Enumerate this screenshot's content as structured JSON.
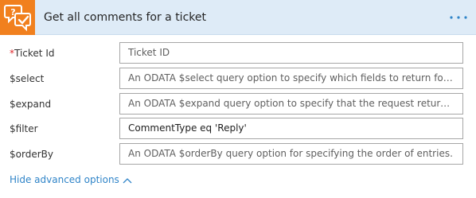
{
  "header": {
    "title": "Get all comments for a ticket",
    "icon": "ticket-comments-icon",
    "menu_icon": "more-options-icon",
    "accent_color": "#f1801e",
    "background_color": "#deebf7"
  },
  "fields": [
    {
      "label": "Ticket Id",
      "required": true,
      "required_marker": "*",
      "value": "",
      "placeholder": "Ticket ID"
    },
    {
      "label": "$select",
      "required": false,
      "value": "",
      "placeholder": "An ODATA $select query option to specify which fields to return for a list ite..."
    },
    {
      "label": "$expand",
      "required": false,
      "value": "",
      "placeholder": "An ODATA $expand query option to specify that the request returns the val..."
    },
    {
      "label": "$filter",
      "required": false,
      "value": "CommentType eq 'Reply'",
      "placeholder": ""
    },
    {
      "label": "$orderBy",
      "required": false,
      "value": "",
      "placeholder": "An ODATA $orderBy query option for specifying the order of entries."
    }
  ],
  "advanced_toggle": {
    "label": "Hide advanced options",
    "icon": "chevron-up-icon",
    "color": "#2f84c8"
  }
}
